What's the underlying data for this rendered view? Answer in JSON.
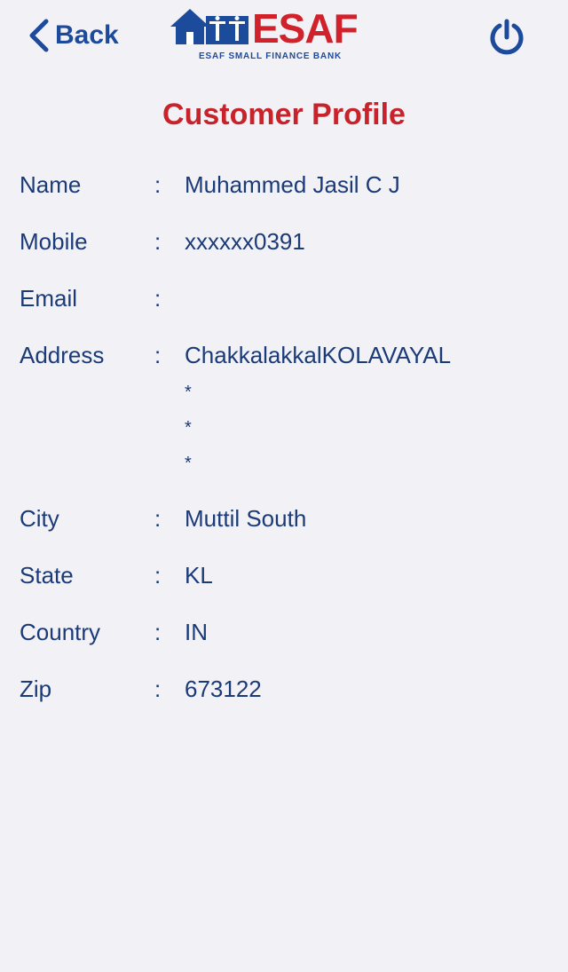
{
  "header": {
    "back_label": "Back",
    "logo_text": "ESAF",
    "logo_tagline": "ESAF SMALL FINANCE BANK",
    "power_icon": "power-icon"
  },
  "page": {
    "title": "Customer Profile"
  },
  "profile": {
    "separator": ":",
    "name": {
      "label": "Name",
      "value": "Muhammed Jasil C J"
    },
    "mobile": {
      "label": "Mobile",
      "value": "xxxxxx0391"
    },
    "email": {
      "label": "Email",
      "value": ""
    },
    "address": {
      "label": "Address",
      "lines": [
        "ChakkalakkalKOLAVAYAL",
        "*",
        "*",
        "*"
      ]
    },
    "city": {
      "label": "City",
      "value": "Muttil South"
    },
    "state": {
      "label": "State",
      "value": "KL"
    },
    "country": {
      "label": "Country",
      "value": "IN"
    },
    "zip": {
      "label": "Zip",
      "value": "673122"
    }
  },
  "colors": {
    "accent_blue": "#1c4b9b",
    "brand_red": "#d1212b",
    "title_red": "#c8222a",
    "text": "#1b3a78",
    "background": "#f2f2f6"
  }
}
